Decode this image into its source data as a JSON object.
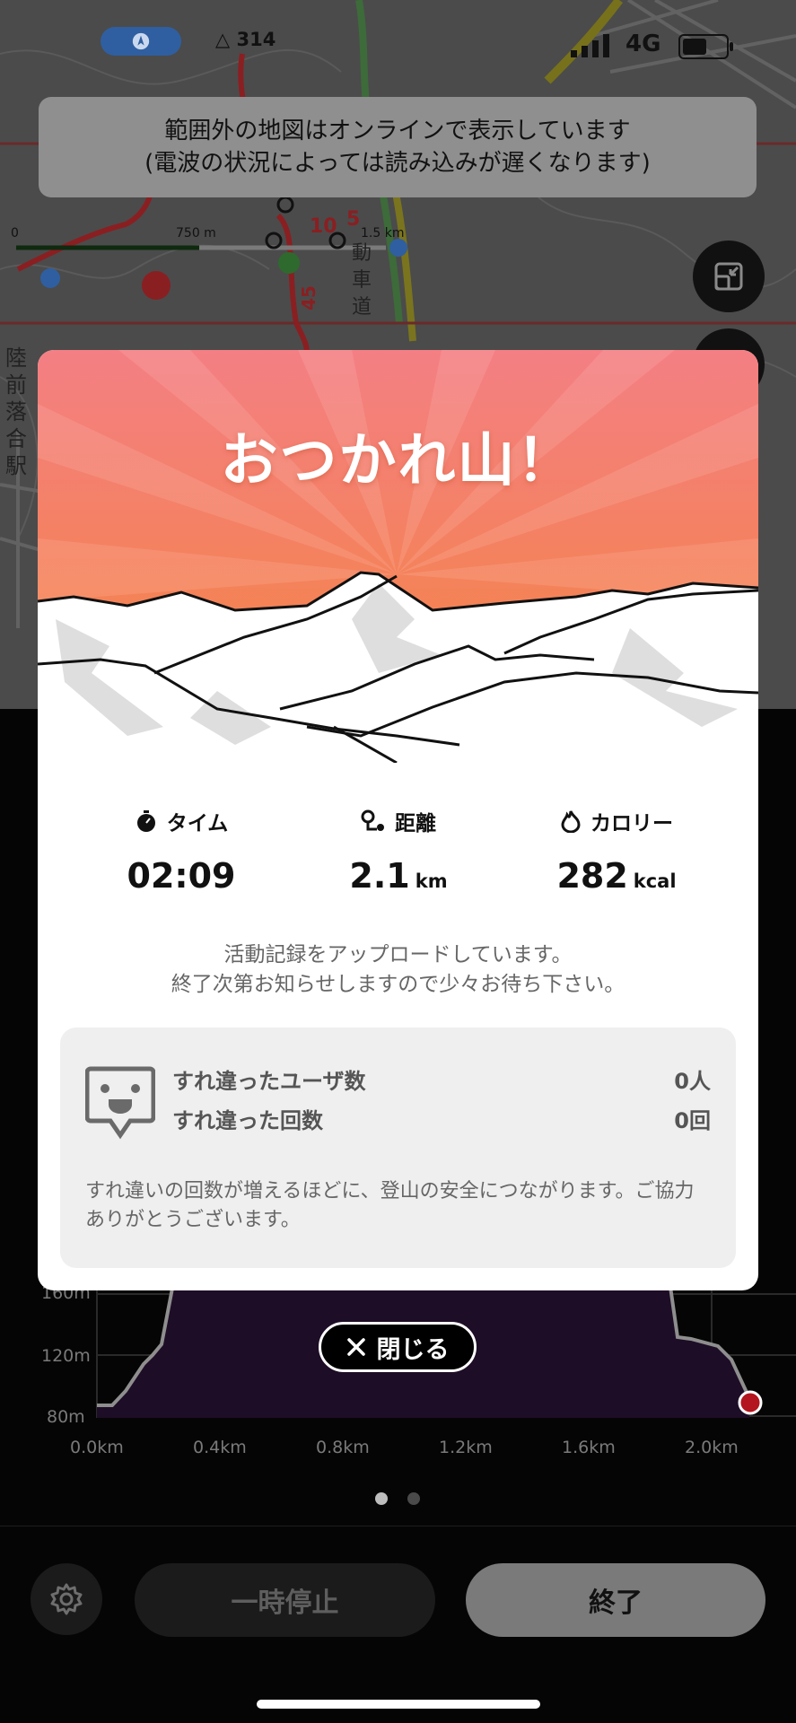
{
  "status_bar": {
    "altitude_value": "314",
    "network_label": "4G",
    "icons": [
      "location-arrow-icon",
      "mountain-icon",
      "signal-icon",
      "battery-icon"
    ]
  },
  "map": {
    "banner_line1": "範囲外の地図はオンラインで表示しています",
    "banner_line2": "(電波の状況によっては読み込みが遅くなります)",
    "scale_labels": [
      "0",
      "750 m",
      "1.5 km"
    ],
    "road_labels": [
      "動",
      "車",
      "道"
    ],
    "station_label": [
      "陸",
      "前",
      "落",
      "合",
      "駅"
    ],
    "route_numbers": [
      "10",
      "5",
      "45"
    ]
  },
  "modal": {
    "title": "おつかれ山！",
    "stats": [
      {
        "label": "タイム",
        "value": "02:09",
        "unit": "",
        "icon": "stopwatch-icon"
      },
      {
        "label": "距離",
        "value": "2.1",
        "unit": "km",
        "icon": "route-icon"
      },
      {
        "label": "カロリー",
        "value": "282",
        "unit": "kcal",
        "icon": "flame-icon"
      }
    ],
    "upload_line1": "活動記録をアップロードしています。",
    "upload_line2": "終了次第お知らせしますので少々お待ち下さい。",
    "pass_users_label": "すれ違ったユーザ数",
    "pass_users_value": "0人",
    "pass_count_label": "すれ違った回数",
    "pass_count_value": "0回",
    "note": "すれ違いの回数が増えるほどに、登山の安全につながります。ご協力ありがとうございます。"
  },
  "close_button": {
    "label": "閉じる"
  },
  "elevation_chart": {
    "y_ticks": [
      "160m",
      "120m",
      "80m"
    ],
    "x_ticks": [
      "0.0km",
      "0.4km",
      "0.8km",
      "1.2km",
      "1.6km",
      "2.0km"
    ]
  },
  "controls": {
    "pause_label": "一時停止",
    "end_label": "終了"
  },
  "colors": {
    "hero_top": "#f47f84",
    "hero_bottom": "#f5843a",
    "panel_bg": "#050505",
    "end_button": "#7a7a7a"
  }
}
